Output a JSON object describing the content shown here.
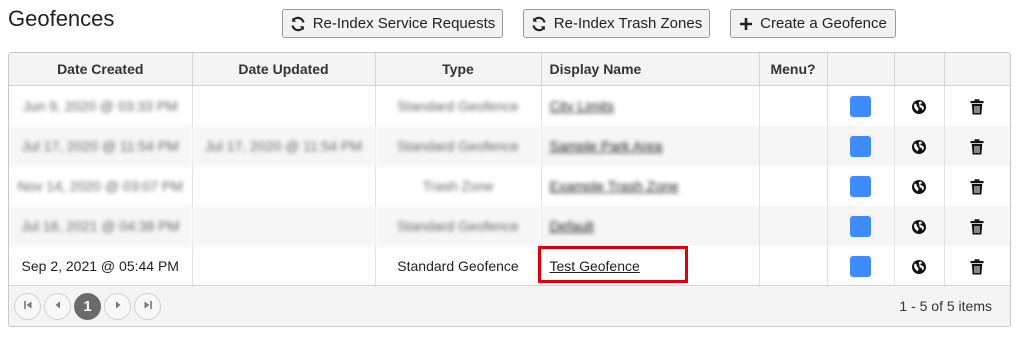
{
  "page": {
    "title": "Geofences"
  },
  "toolbar": {
    "reindex_service_label": "Re-Index Service Requests",
    "reindex_trash_label": "Re-Index Trash Zones",
    "create_label": "Create a Geofence"
  },
  "table": {
    "headers": [
      "Date Created",
      "Date Updated",
      "Type",
      "Display Name",
      "Menu?",
      "",
      "",
      ""
    ],
    "rows": [
      {
        "created": "Jun 9, 2020 @ 03:33 PM",
        "updated": "",
        "type": "Standard Geofence",
        "name": "City Limits"
      },
      {
        "created": "Jul 17, 2020 @ 11:54 PM",
        "updated": "Jul 17, 2020 @ 11:54 PM",
        "type": "Standard Geofence",
        "name": "Sample Park Area"
      },
      {
        "created": "Nov 14, 2020 @ 03:07 PM",
        "updated": "",
        "type": "Trash Zone",
        "name": "Example Trash Zone"
      },
      {
        "created": "Jul 16, 2021 @ 04:38 PM",
        "updated": "",
        "type": "Standard Geofence",
        "name": "Default"
      },
      {
        "created": "Sep 2, 2021 @ 05:44 PM",
        "updated": "",
        "type": "Standard Geofence",
        "name": "Test Geofence"
      }
    ]
  },
  "pager": {
    "current_page": "1",
    "info": "1 - 5 of 5 items"
  },
  "colors": {
    "swatch": "#3d8bfd",
    "highlight": "#e0000b"
  },
  "icons": {
    "refresh": "refresh-icon",
    "plus": "plus-icon",
    "globe": "globe-icon",
    "trash": "trash-icon",
    "first": "first-page-icon",
    "prev": "prev-page-icon",
    "next": "next-page-icon",
    "last": "last-page-icon"
  }
}
